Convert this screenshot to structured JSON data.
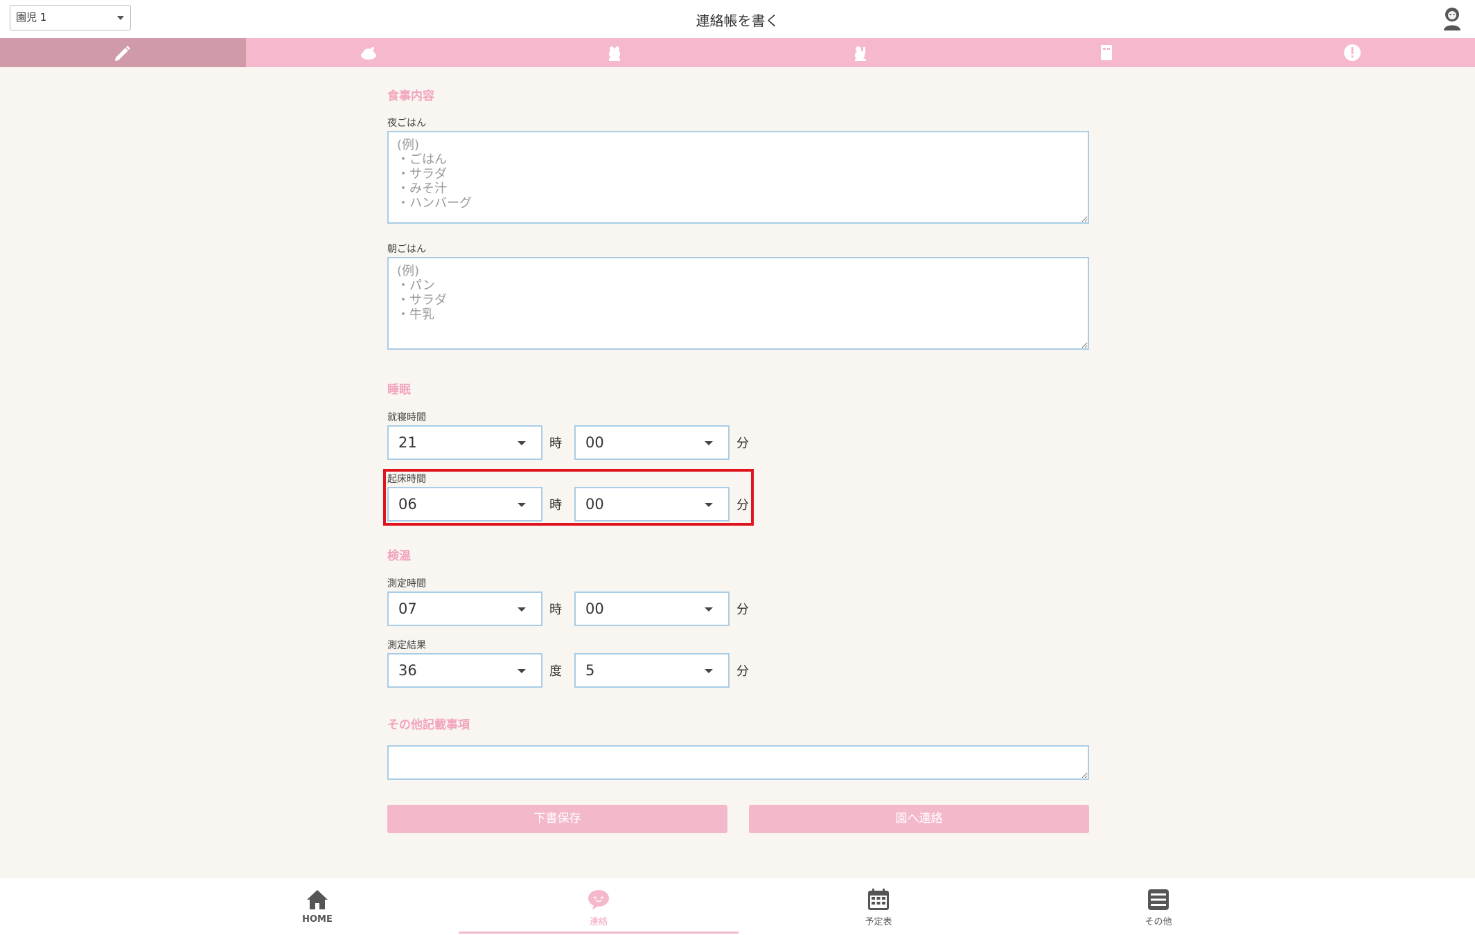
{
  "header": {
    "child_select": "園児 1",
    "title": "連絡帳を書く"
  },
  "tabs": [
    {
      "icon": "pencil-icon",
      "active": true
    },
    {
      "icon": "meal-icon",
      "active": false
    },
    {
      "icon": "sleep-icon",
      "active": false
    },
    {
      "icon": "thermometer-icon",
      "active": false
    },
    {
      "icon": "note-icon",
      "active": false
    },
    {
      "icon": "alert-icon",
      "active": false
    }
  ],
  "meal": {
    "section_title": "食事内容",
    "dinner_label": "夜ごはん",
    "dinner_placeholder": "(例)\n・ごはん\n・サラダ\n・みそ汁\n・ハンバーグ",
    "breakfast_label": "朝ごはん",
    "breakfast_placeholder": "(例)\n・パン\n・サラダ\n・牛乳"
  },
  "sleep": {
    "section_title": "睡眠",
    "bedtime_label": "就寝時間",
    "bedtime_hour": "21",
    "bedtime_minute": "00",
    "wakeup_label": "起床時間",
    "wakeup_hour": "06",
    "wakeup_minute": "00"
  },
  "temperature": {
    "section_title": "検温",
    "time_label": "測定時間",
    "time_hour": "07",
    "time_minute": "00",
    "result_label": "測定結果",
    "result_degree": "36",
    "result_decimal": "5"
  },
  "units": {
    "hour": "時",
    "minute": "分",
    "degree": "度"
  },
  "other": {
    "section_title": "その他記載事項"
  },
  "buttons": {
    "save_draft": "下書保存",
    "send": "園へ連絡"
  },
  "bottom_nav": [
    {
      "label": "HOME",
      "icon": "home-icon",
      "active": false
    },
    {
      "label": "連絡",
      "icon": "chat-icon",
      "active": true
    },
    {
      "label": "予定表",
      "icon": "calendar-icon",
      "active": false
    },
    {
      "label": "その他",
      "icon": "menu-icon",
      "active": false
    }
  ],
  "colors": {
    "accent_pink": "#f4b8cb",
    "active_tab": "#d09aa9",
    "section_title": "#f2a4bd",
    "input_border": "#a9cde6",
    "highlight": "#e0141f",
    "background": "#f9f5f1"
  }
}
